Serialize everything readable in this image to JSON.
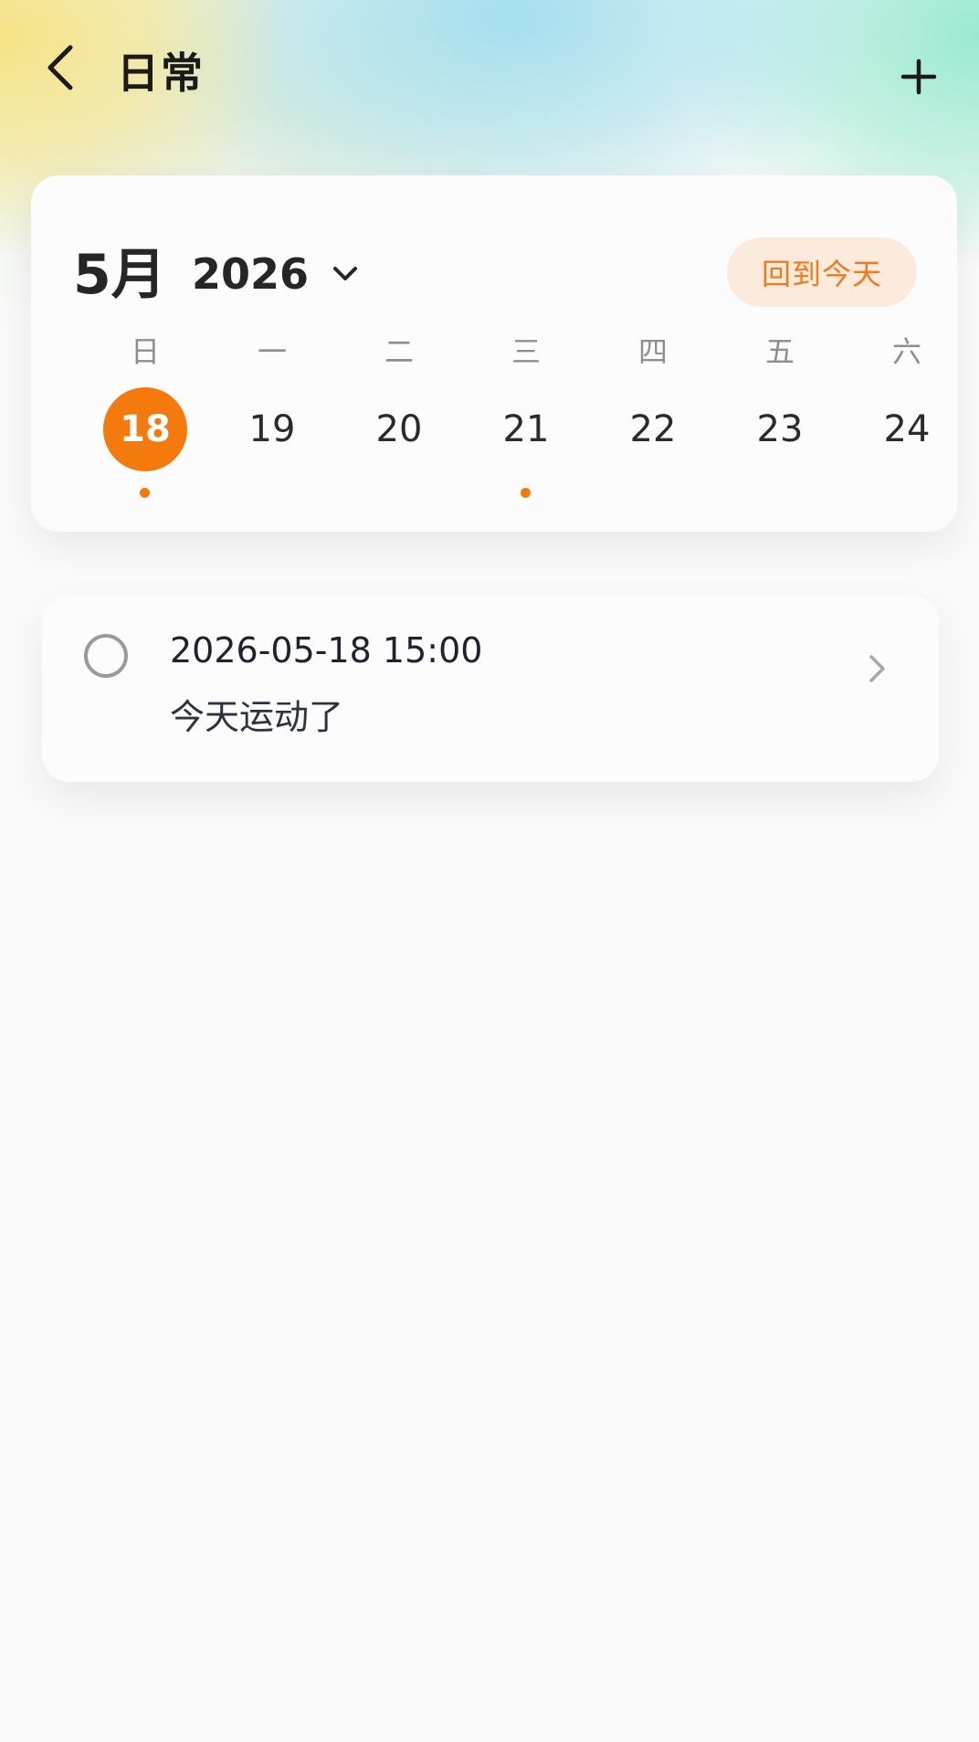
{
  "header": {
    "title": "日常",
    "back_icon": "chevron-left-icon",
    "add_icon": "plus-icon"
  },
  "calendar": {
    "month": "5月",
    "year": "2026",
    "today_button": "回到今天",
    "weekdays": [
      "日",
      "一",
      "二",
      "三",
      "四",
      "五",
      "六"
    ],
    "days": [
      {
        "label": "18",
        "selected": true,
        "has_event": true
      },
      {
        "label": "19",
        "selected": false,
        "has_event": false
      },
      {
        "label": "20",
        "selected": false,
        "has_event": false
      },
      {
        "label": "21",
        "selected": false,
        "has_event": true
      },
      {
        "label": "22",
        "selected": false,
        "has_event": false
      },
      {
        "label": "23",
        "selected": false,
        "has_event": false
      },
      {
        "label": "24",
        "selected": false,
        "has_event": false
      }
    ]
  },
  "tasks": [
    {
      "time": "2026-05-18 15:00",
      "title": "今天运动了",
      "done": false
    }
  ],
  "colors": {
    "accent": "#f57a0e",
    "accent_soft": "#fcebdd",
    "text_dark": "#262626",
    "text_muted": "#8e8e8e"
  }
}
